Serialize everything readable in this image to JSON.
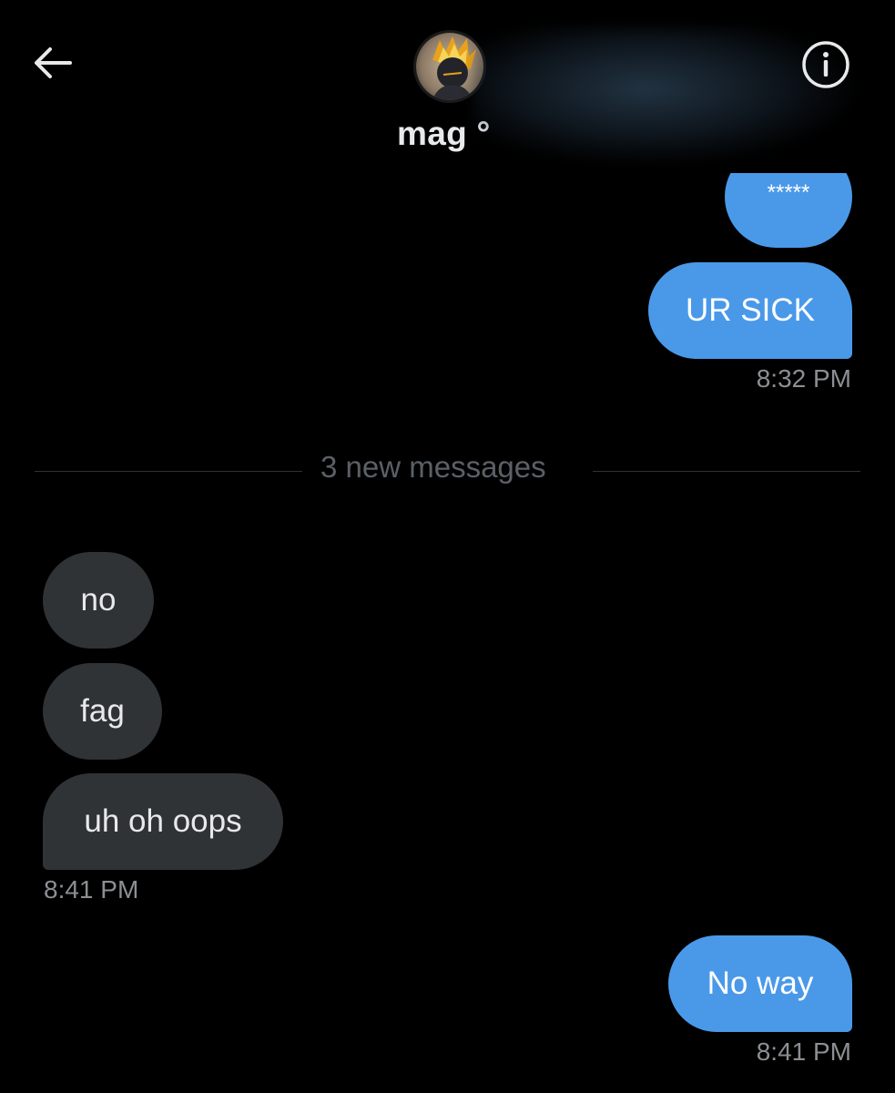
{
  "header": {
    "back_icon": "arrow-left-icon",
    "contact_name": "mag °",
    "info_icon": "info-circle-icon"
  },
  "messages": {
    "m1": {
      "direction": "sent",
      "text": "*****"
    },
    "m2": {
      "direction": "sent",
      "text": "UR SICK"
    },
    "ts1": "8:32 PM",
    "divider": "3 new messages",
    "m3": {
      "direction": "received",
      "text": "no"
    },
    "m4": {
      "direction": "received",
      "text": "fag"
    },
    "m5": {
      "direction": "received",
      "text": "uh oh oops"
    },
    "ts2": "8:41 PM",
    "m6": {
      "direction": "sent",
      "text": "No way"
    },
    "ts3": "8:41 PM"
  },
  "colors": {
    "background": "#000000",
    "sent_bubble": "#4a99e9",
    "received_bubble": "#2f3336",
    "timestamp": "#8b8f93",
    "divider_text": "#5b6066"
  }
}
